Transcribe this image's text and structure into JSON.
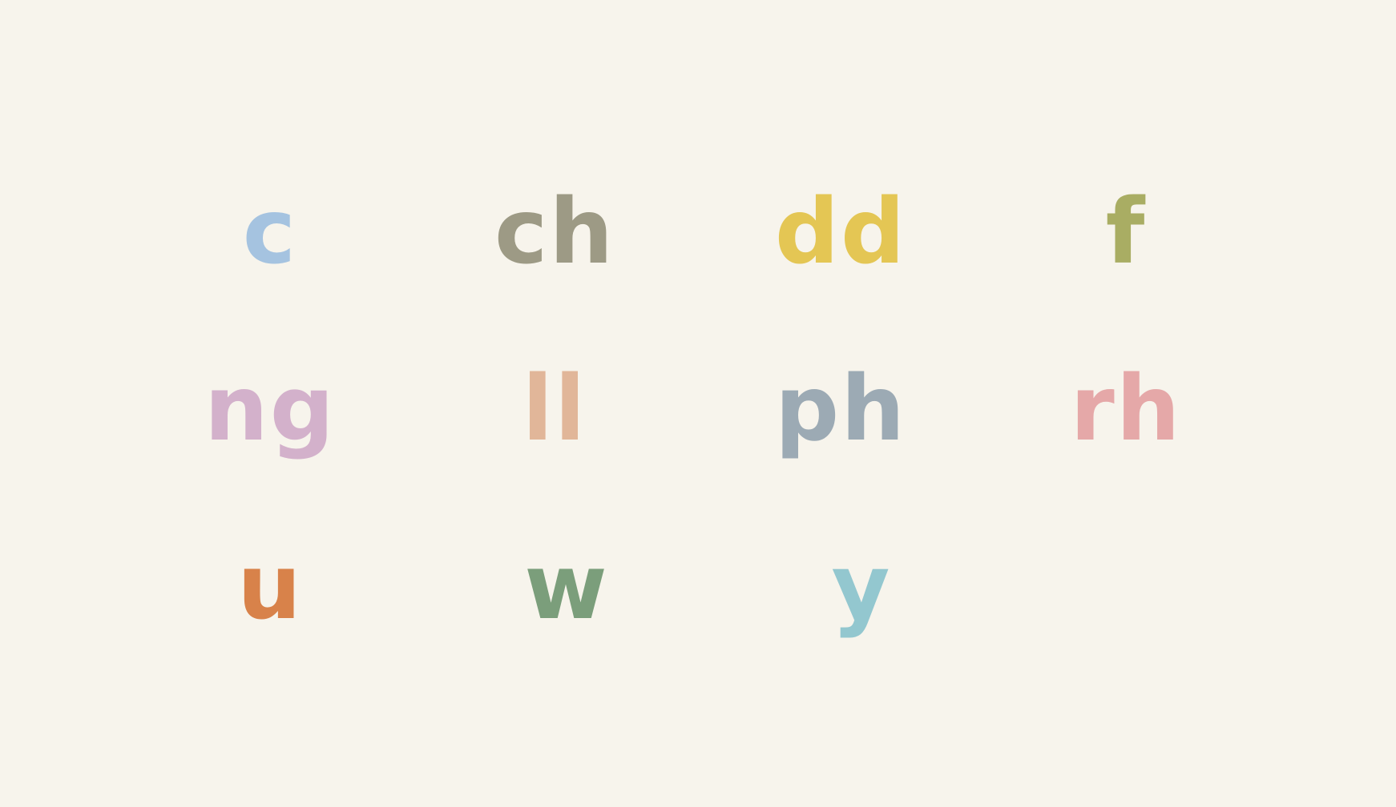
{
  "tiles": [
    {
      "label": "c",
      "color": "#a5c3e0"
    },
    {
      "label": "ch",
      "color": "#9d9a85"
    },
    {
      "label": "dd",
      "color": "#e4c654"
    },
    {
      "label": "f",
      "color": "#a9ad63"
    },
    {
      "label": "ng",
      "color": "#d3b1cb"
    },
    {
      "label": "ll",
      "color": "#e1b699"
    },
    {
      "label": "ph",
      "color": "#9caab4"
    },
    {
      "label": "rh",
      "color": "#e5a8a8"
    },
    {
      "label": "u",
      "color": "#d8824a"
    },
    {
      "label": "w",
      "color": "#7b9e7b"
    },
    {
      "label": "y",
      "color": "#93c7cf"
    }
  ]
}
